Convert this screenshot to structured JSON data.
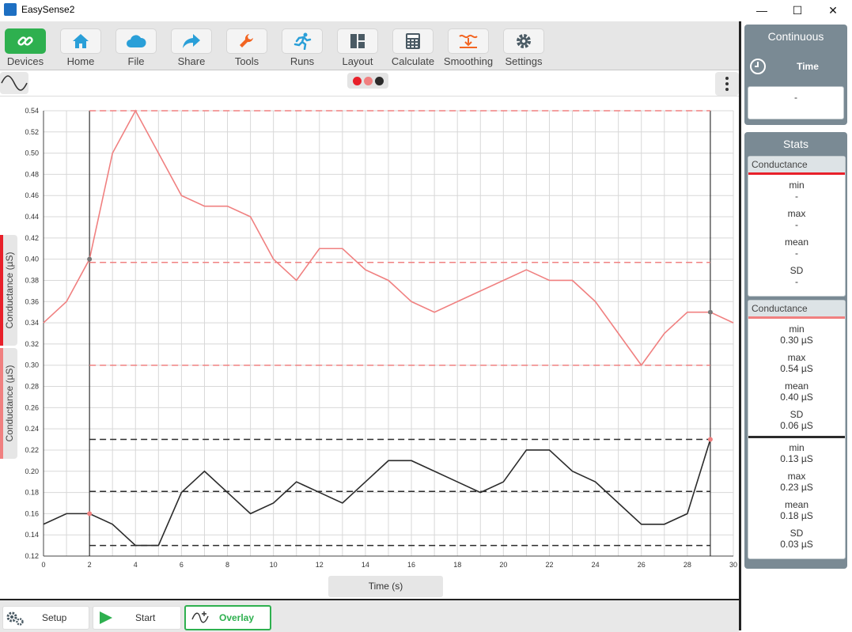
{
  "window": {
    "title": "EasySense2",
    "minimize": "—",
    "maximize": "☐",
    "close": "✕"
  },
  "toolbar": [
    {
      "label": "Devices",
      "icon": "link-icon"
    },
    {
      "label": "Home",
      "icon": "home-icon"
    },
    {
      "label": "File",
      "icon": "cloud-icon"
    },
    {
      "label": "Share",
      "icon": "share-icon"
    },
    {
      "label": "Tools",
      "icon": "wrench-icon"
    },
    {
      "label": "Runs",
      "icon": "runner-icon"
    },
    {
      "label": "Layout",
      "icon": "layout-icon"
    },
    {
      "label": "Calculate",
      "icon": "calculator-icon"
    },
    {
      "label": "Smoothing",
      "icon": "smoothing-icon"
    },
    {
      "label": "Settings",
      "icon": "gear-icon"
    }
  ],
  "colors": {
    "red": "#e8202a",
    "pink": "#f08080",
    "dark": "#2b2b2b",
    "green": "#2eb04f"
  },
  "axis_tabs": {
    "left_top": "Conductance  (µS)",
    "left_bottom": "Conductance  (µS)",
    "bottom": "Time  (s)"
  },
  "sidebar": {
    "mode": "Continuous",
    "time": {
      "title": "Time",
      "value": "-"
    },
    "stats_title": "Stats",
    "card1": {
      "header": "Conductance",
      "items": [
        {
          "k": "min",
          "v": "-"
        },
        {
          "k": "max",
          "v": "-"
        },
        {
          "k": "mean",
          "v": "-"
        },
        {
          "k": "SD",
          "v": "-"
        }
      ]
    },
    "card2": {
      "header": "Conductance",
      "group1": [
        {
          "k": "min",
          "v": "0.30 µS"
        },
        {
          "k": "max",
          "v": "0.54 µS"
        },
        {
          "k": "mean",
          "v": "0.40 µS"
        },
        {
          "k": "SD",
          "v": "0.06 µS"
        }
      ],
      "group2": [
        {
          "k": "min",
          "v": "0.13 µS"
        },
        {
          "k": "max",
          "v": "0.23 µS"
        },
        {
          "k": "mean",
          "v": "0.18 µS"
        },
        {
          "k": "SD",
          "v": "0.03 µS"
        }
      ]
    }
  },
  "bottom": {
    "setup": "Setup",
    "start": "Start",
    "overlay": "Overlay"
  },
  "chart_data": {
    "type": "line",
    "xlabel": "Time  (s)",
    "ylabel": "Conductance  (µS)",
    "xlim": [
      0,
      30
    ],
    "ylim": [
      0.12,
      0.54
    ],
    "xticks": [
      0,
      2,
      4,
      6,
      8,
      10,
      12,
      14,
      16,
      18,
      20,
      22,
      24,
      26,
      28,
      30
    ],
    "yticks": [
      0.12,
      0.14,
      0.16,
      0.18,
      0.2,
      0.22,
      0.24,
      0.26,
      0.28,
      0.3,
      0.32,
      0.34,
      0.36,
      0.38,
      0.4,
      0.42,
      0.44,
      0.46,
      0.48,
      0.5,
      0.52,
      0.54
    ],
    "grid": true,
    "cursors_x": [
      2,
      29
    ],
    "series": [
      {
        "color": "#f08080",
        "x": [
          0,
          1,
          2,
          3,
          4,
          5,
          6,
          7,
          8,
          9,
          10,
          11,
          12,
          13,
          14,
          15,
          16,
          17,
          18,
          19,
          20,
          21,
          22,
          23,
          24,
          25,
          26,
          27,
          28,
          29,
          30
        ],
        "y": [
          0.34,
          0.36,
          0.4,
          0.5,
          0.54,
          0.5,
          0.46,
          0.45,
          0.45,
          0.44,
          0.4,
          0.38,
          0.41,
          0.41,
          0.39,
          0.38,
          0.36,
          0.35,
          0.36,
          0.37,
          0.38,
          0.39,
          0.38,
          0.38,
          0.36,
          0.33,
          0.3,
          0.33,
          0.35,
          0.35,
          0.34
        ],
        "stats": {
          "min": 0.3,
          "max": 0.54,
          "mean": 0.397
        }
      },
      {
        "color": "#2b2b2b",
        "x": [
          0,
          1,
          2,
          3,
          4,
          5,
          6,
          7,
          8,
          9,
          10,
          11,
          12,
          13,
          14,
          15,
          16,
          17,
          18,
          19,
          20,
          21,
          22,
          23,
          24,
          25,
          26,
          27,
          28,
          29
        ],
        "y": [
          0.15,
          0.16,
          0.16,
          0.15,
          0.13,
          0.13,
          0.18,
          0.2,
          0.18,
          0.16,
          0.17,
          0.19,
          0.18,
          0.17,
          0.19,
          0.21,
          0.21,
          0.2,
          0.19,
          0.18,
          0.19,
          0.22,
          0.22,
          0.2,
          0.19,
          0.17,
          0.15,
          0.15,
          0.16,
          0.23
        ],
        "stats": {
          "min": 0.13,
          "max": 0.23,
          "mean": 0.181
        }
      }
    ]
  }
}
